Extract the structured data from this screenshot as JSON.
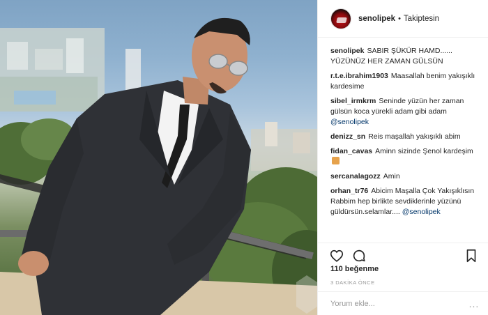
{
  "post": {
    "username": "senolipek",
    "separator": "•",
    "follow_status": "Takiptesin",
    "caption_user": "senolipek",
    "caption_text": "SABIR ŞÜKÜR HAMD...... YÜZÜNÜZ HER ZAMAN GÜLSÜN"
  },
  "comments": [
    {
      "user": "r.t.e.ibrahim1903",
      "text": "Maasallah benim yakışıklı kardesime"
    },
    {
      "user": "sibel_irmkrm",
      "text": "Seninde yüzün her zaman gülsün koca yürekli adam gibi adam",
      "mention": "@senolipek"
    },
    {
      "user": "denizz_sn",
      "text": "Reis maşallah yakışıklı abim"
    },
    {
      "user": "fidan_cavas",
      "text": "Aminn sizinde Şenol kardeşim",
      "emoji": "praying-hands"
    },
    {
      "user": "sercanalagozz",
      "text": "Amin"
    },
    {
      "user": "orhan_tr76",
      "text": "Abicim Maşalla Çok Yakışıklısın Rabbim hep birlikte sevdiklerinle yüzünü güldürsün.selamlar....",
      "mention": "@senolipek"
    }
  ],
  "stats": {
    "likes": "110 beğenme",
    "time": "3 DAKİKA ÖNCE"
  },
  "comment_box": {
    "placeholder": "Yorum ekle...",
    "more": "..."
  },
  "icons": {
    "like": "heart-icon",
    "comment": "comment-bubble-icon",
    "save": "bookmark-icon"
  },
  "colors": {
    "mention": "#003569",
    "border": "#efefef",
    "muted": "#999999"
  }
}
